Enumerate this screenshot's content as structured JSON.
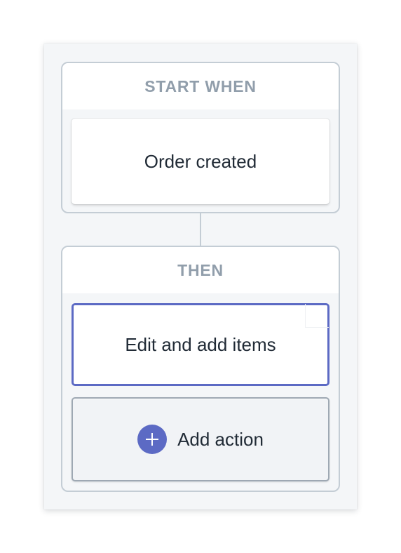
{
  "workflow": {
    "trigger_section": {
      "header": "START WHEN",
      "card_label": "Order created"
    },
    "action_section": {
      "header": "THEN",
      "selected_action_label": "Edit and add items",
      "add_action_label": "Add action",
      "add_icon": "plus-icon"
    }
  },
  "colors": {
    "canvas_bg": "#f4f6f8",
    "section_border": "#c4cdd5",
    "header_text": "#919eab",
    "accent": "#5c6ac4",
    "body_text": "#212b36"
  }
}
